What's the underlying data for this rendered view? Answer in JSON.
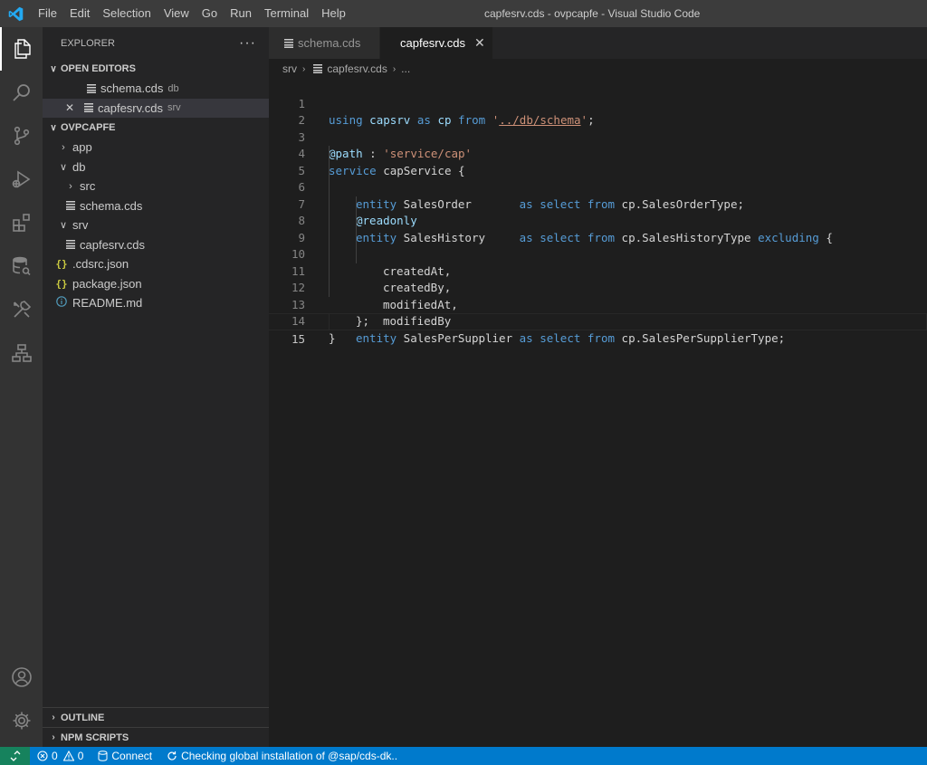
{
  "window": {
    "title": "capfesrv.cds - ovpcapfe - Visual Studio Code"
  },
  "menu": [
    "File",
    "Edit",
    "Selection",
    "View",
    "Go",
    "Run",
    "Terminal",
    "Help"
  ],
  "sidebar": {
    "header": "EXPLORER",
    "more": "···",
    "open_editors": {
      "title": "OPEN EDITORS",
      "items": [
        {
          "name": "schema.cds",
          "desc": "db"
        },
        {
          "name": "capfesrv.cds",
          "desc": "srv",
          "close": "✕"
        }
      ]
    },
    "folder": {
      "title": "OVPCAPFE",
      "items": [
        "app",
        "db",
        "src",
        "schema.cds",
        "srv",
        "capfesrv.cds",
        ".cdsrc.json",
        "package.json",
        "README.md"
      ]
    },
    "outline": "OUTLINE",
    "npm_scripts": "NPM SCRIPTS"
  },
  "tabs": [
    {
      "label": "schema.cds"
    },
    {
      "label": "capfesrv.cds",
      "close": "✕"
    }
  ],
  "breadcrumb": {
    "folder": "srv",
    "file": "capfesrv.cds",
    "more": "..."
  },
  "code": {
    "line_numbers": [
      "1",
      "2",
      "3",
      "4",
      "5",
      "6",
      "7",
      "8",
      "9",
      "10",
      "11",
      "12",
      "13",
      "14",
      "15"
    ],
    "l1": {
      "k1": "using",
      "id1": "capsrv",
      "k2": "as",
      "id2": "cp",
      "k3": "from",
      "q1": "'",
      "path": "../db/schema",
      "q2": "'",
      "end": ";"
    },
    "l3": {
      "ann": "@path",
      "sep": " : ",
      "str": "'service/cap'"
    },
    "l4": {
      "k": "service",
      "name": " capService {"
    },
    "l5": {
      "k": "entity",
      "name": " SalesOrder       ",
      "k2": "as",
      "k3": "select",
      "k4": "from",
      "rest": " cp.SalesOrderType;"
    },
    "l6": {
      "ann": "@readonly"
    },
    "l7": {
      "k": "entity",
      "name": " SalesHistory     ",
      "k2": "as",
      "k3": "select",
      "k4": "from",
      "rest": " cp.SalesHistoryType ",
      "k5": "excluding",
      "end": " {"
    },
    "l8": "createdAt,",
    "l9": "createdBy,",
    "l10": "modifiedAt,",
    "l11": "modifiedBy",
    "l12": "};",
    "l13": {
      "k": "entity",
      "name": " SalesPerSupplier ",
      "k2": "as",
      "k3": "select",
      "k4": "from",
      "rest": " cp.SalesPerSupplierType;"
    },
    "l14": "}"
  },
  "status": {
    "errors": "0",
    "warnings": "0",
    "connect": "Connect",
    "message": "Checking global installation of @sap/cds-dk.."
  },
  "colors": {
    "accent": "#007acc",
    "remote": "#16825d"
  }
}
